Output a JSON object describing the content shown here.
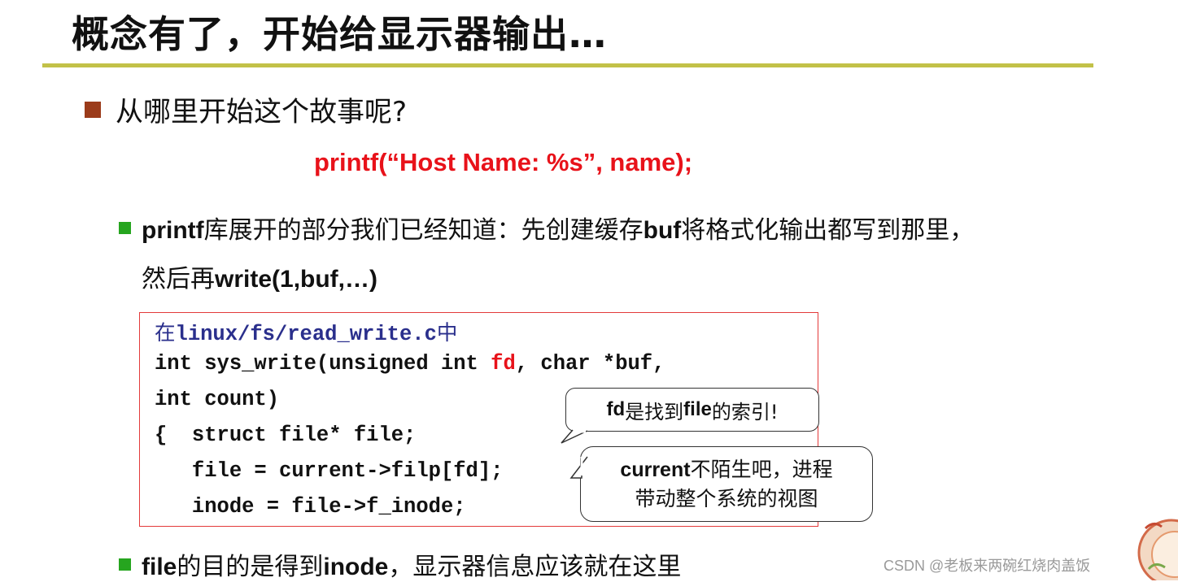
{
  "slide": {
    "title": "概念有了，开始给显示器输出…",
    "bullet1": "从哪里开始这个故事呢?",
    "printf_example": "printf(“Host Name: %s”, name);",
    "bullet2": {
      "part1": "printf",
      "part2": "库展开的部分我们已经知道：先创建缓存",
      "part3": "buf",
      "part4": "将格式化输出都写到那里，",
      "line2a": "然后再",
      "line2b": "write(1,buf,…)"
    },
    "code": {
      "line0_a": "在",
      "line0_b": "linux/fs/read_write.c",
      "line0_c": "中",
      "line1_a": "int sys_write(unsigned int ",
      "line1_b": "fd",
      "line1_c": ", char *buf,",
      "line2": "int count)",
      "line3": "{  struct file* file;",
      "line4": "   file = current->filp[fd];",
      "line5": "   inode = file->f_inode;"
    },
    "callout1": {
      "a": "fd",
      "b": "是找到",
      "c": "file",
      "d": "的索引!"
    },
    "callout2": {
      "a": "current",
      "b": "不陌生吧，进程",
      "line2": "带动整个系统的视图"
    },
    "bullet3": {
      "a": "file",
      "b": "的目的是得到",
      "c": "inode",
      "d": "，显示器信息应该就在这里"
    },
    "watermark": "CSDN @老板来两碗红烧肉盖饭"
  },
  "colors": {
    "title_rule": "#c2c148",
    "level1_bullet": "#9b3b1a",
    "level2_bullet": "#26a51f",
    "highlight_red": "#e8121a",
    "code_path_blue": "#2a2f8c",
    "code_box_border": "#e33a3a"
  }
}
